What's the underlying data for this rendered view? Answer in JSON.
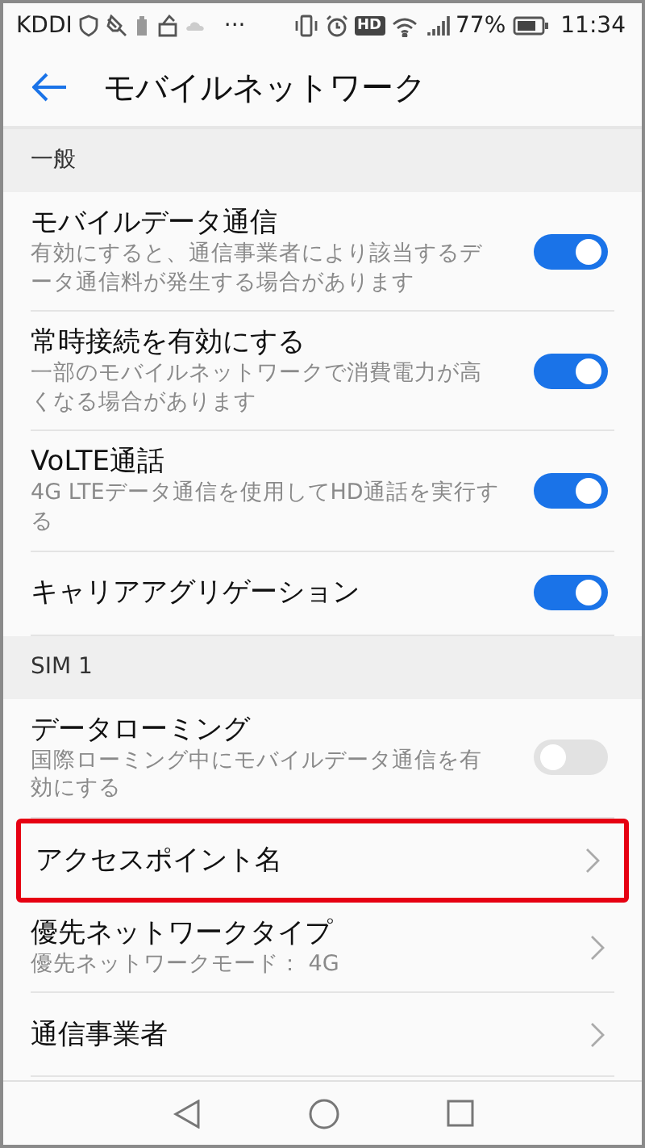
{
  "status_bar": {
    "carrier": "KDDI",
    "more": "···",
    "hd": "HD",
    "battery": "77%",
    "time": "11:34"
  },
  "header": {
    "title": "モバイルネットワーク"
  },
  "sections": [
    {
      "title": "一般",
      "items": [
        {
          "kind": "toggle",
          "title": "モバイルデータ通信",
          "subtitle": "有効にすると、通信事業者により該当するデータ通信料が発生する場合があります",
          "on": true
        },
        {
          "kind": "toggle",
          "title": "常時接続を有効にする",
          "subtitle": "一部のモバイルネットワークで消費電力が高くなる場合があります",
          "on": true
        },
        {
          "kind": "toggle",
          "title": "VoLTE通話",
          "subtitle": "4G LTEデータ通信を使用してHD通話を実行する",
          "on": true
        },
        {
          "kind": "toggle",
          "title": "キャリアアグリゲーション",
          "on": true
        }
      ]
    },
    {
      "title": "SIM 1",
      "items": [
        {
          "kind": "toggle",
          "title": "データローミング",
          "subtitle": "国際ローミング中にモバイルデータ通信を有効にする",
          "on": false
        },
        {
          "kind": "link",
          "title": "アクセスポイント名",
          "highlighted": true
        },
        {
          "kind": "link",
          "title": "優先ネットワークタイプ",
          "subtitle": "優先ネットワークモード： 4G",
          "highlighted": false
        },
        {
          "kind": "link",
          "title": "通信事業者",
          "highlighted": false
        }
      ]
    }
  ]
}
